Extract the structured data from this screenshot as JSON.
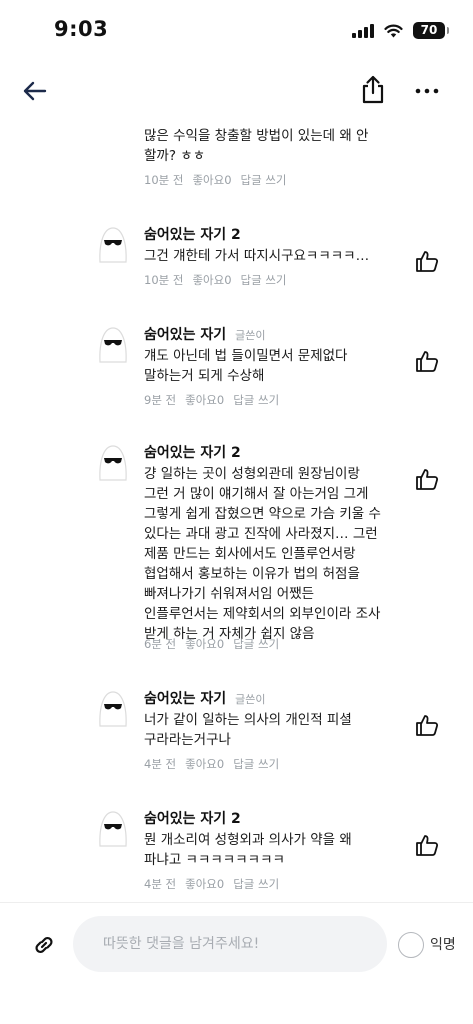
{
  "status_bar": {
    "time": "9:03",
    "battery_percent": "70"
  },
  "nav": {
    "back_icon": "arrow-left-icon",
    "share_icon": "share-icon",
    "more_icon": "more-horizontal-icon"
  },
  "comments": [
    {
      "author": "",
      "is_op": false,
      "op_label": "",
      "text": "많은 수익을 창출할 방법이 있는데 왜 안 할까? ㅎㅎ",
      "time": "10분 전",
      "likes_label": "좋아요0",
      "reply_label": "답글 쓰기",
      "has_like_button": false
    },
    {
      "author": "숨어있는 자기 2",
      "is_op": false,
      "op_label": "",
      "text": "그건 걔한테 가서 따지시구요ㅋㅋㅋㅋ…",
      "time": "10분 전",
      "likes_label": "좋아요0",
      "reply_label": "답글 쓰기",
      "has_like_button": true
    },
    {
      "author": "숨어있는 자기",
      "is_op": true,
      "op_label": "글쓴이",
      "text": "걔도 아닌데 법 들이밀면서 문제없다 말하는거 되게 수상해",
      "time": "9분 전",
      "likes_label": "좋아요0",
      "reply_label": "답글 쓰기",
      "has_like_button": true
    },
    {
      "author": "숨어있는 자기 2",
      "is_op": false,
      "op_label": "",
      "text": "걍 일하는 곳이 성형외관데 원장님이랑 그런 거 많이 얘기해서 잘 아는거임 그게 그렇게 쉽게 잡혔으면 약으로 가슴 키울 수 있다는 과대 광고 진작에 사라졌지… 그런 제품 만드는 회사에서도 인플루언서랑 협업해서 홍보하는 이유가 법의 허점을 빠져나가기 쉬워져서임 어쨌든 인플루언서는 제약회서의 외부인이라 조사 받게 하는 거 자체가 쉽지 않음",
      "time": "6분 전",
      "likes_label": "좋아요0",
      "reply_label": "답글 쓰기",
      "has_like_button": true
    },
    {
      "author": "숨어있는 자기",
      "is_op": true,
      "op_label": "글쓴이",
      "text": "너가 같이 일하는 의사의 개인적 피셜 구라라는거구나",
      "time": "4분 전",
      "likes_label": "좋아요0",
      "reply_label": "답글 쓰기",
      "has_like_button": true
    },
    {
      "author": "숨어있는 자기 2",
      "is_op": false,
      "op_label": "",
      "text": "뭔 개소리여 성형외과 의사가 약을 왜 파냐고 ㅋㅋㅋㅋㅋㅋㅋㅋ",
      "time": "4분 전",
      "likes_label": "좋아요0",
      "reply_label": "답글 쓰기",
      "has_like_button": true
    }
  ],
  "input_bar": {
    "placeholder": "따뜻한 댓글을 남겨주세요!",
    "value": "",
    "anonymous_label": "익명",
    "anonymous_checked": false
  }
}
